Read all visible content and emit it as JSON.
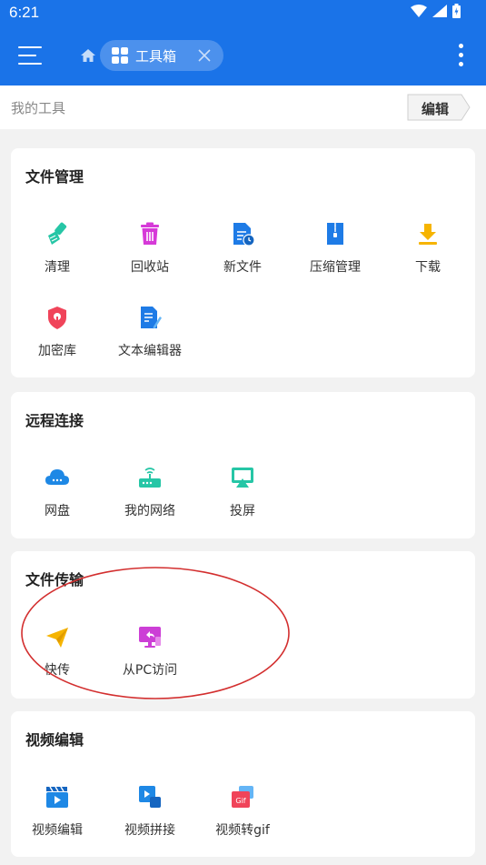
{
  "status_bar": {
    "time": "6:21"
  },
  "app_bar": {
    "tab_label": "工具箱"
  },
  "my_tools": {
    "title": "我的工具",
    "edit_label": "编辑"
  },
  "sections": [
    {
      "title": "文件管理",
      "tools": [
        {
          "label": "清理",
          "icon": "broom-icon"
        },
        {
          "label": "回收站",
          "icon": "trash-icon"
        },
        {
          "label": "新文件",
          "icon": "new-file-icon"
        },
        {
          "label": "压缩管理",
          "icon": "zip-icon"
        },
        {
          "label": "下载",
          "icon": "download-icon"
        },
        {
          "label": "加密库",
          "icon": "lock-shield-icon"
        },
        {
          "label": "文本编辑器",
          "icon": "text-editor-icon"
        }
      ]
    },
    {
      "title": "远程连接",
      "tools": [
        {
          "label": "网盘",
          "icon": "cloud-icon"
        },
        {
          "label": "我的网络",
          "icon": "router-icon"
        },
        {
          "label": "投屏",
          "icon": "cast-icon"
        }
      ]
    },
    {
      "title": "文件传输",
      "tools": [
        {
          "label": "快传",
          "icon": "paper-plane-icon"
        },
        {
          "label": "从PC访问",
          "icon": "pc-access-icon"
        }
      ]
    },
    {
      "title": "视频编辑",
      "tools": [
        {
          "label": "视频编辑",
          "icon": "clapperboard-icon"
        },
        {
          "label": "视频拼接",
          "icon": "video-merge-icon"
        },
        {
          "label": "视频转gif",
          "icon": "gif-icon"
        }
      ]
    }
  ],
  "gif_badge": "Gif",
  "colors": {
    "app_bar": "#1a73e8",
    "annotation": "#d32f2f"
  }
}
